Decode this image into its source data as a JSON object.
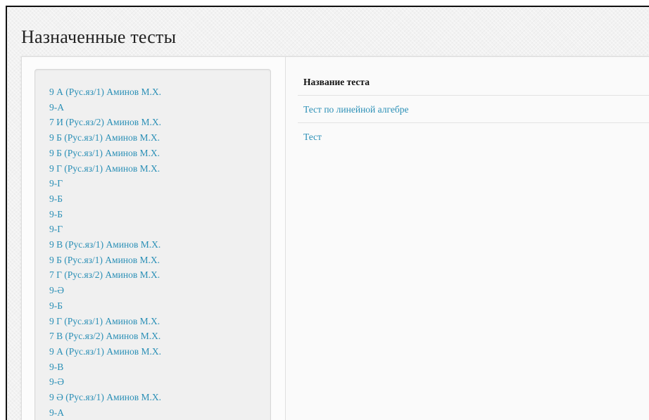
{
  "page": {
    "title": "Назначенные тесты"
  },
  "sidebar": {
    "classes": [
      "9 А (Рус.яз/1) Аминов М.Х.",
      "9-А",
      "7 И (Рус.яз/2) Аминов М.Х.",
      "9 Б (Рус.яз/1) Аминов М.Х.",
      "9 Б (Рус.яз/1) Аминов М.Х.",
      "9 Г (Рус.яз/1) Аминов М.Х.",
      "9-Г",
      "9-Б",
      "9-Б",
      "9-Г",
      "9 В (Рус.яз/1) Аминов М.Х.",
      "9 Б (Рус.яз/1) Аминов М.Х.",
      "7 Г (Рус.яз/2) Аминов М.Х.",
      "9-Ә",
      "9-Б",
      "9 Г (Рус.яз/1) Аминов М.Х.",
      "7 В (Рус.яз/2) Аминов М.Х.",
      "9 А (Рус.яз/1) Аминов М.Х.",
      "9-В",
      "9-Ә",
      "9 Ә (Рус.яз/1) Аминов М.Х.",
      "9-А"
    ]
  },
  "tests": {
    "header": "Название теста",
    "rows": [
      "Тест по линейной алгебре",
      "Тест"
    ]
  },
  "colors": {
    "link": "#2a8fb6",
    "title": "#222222"
  }
}
